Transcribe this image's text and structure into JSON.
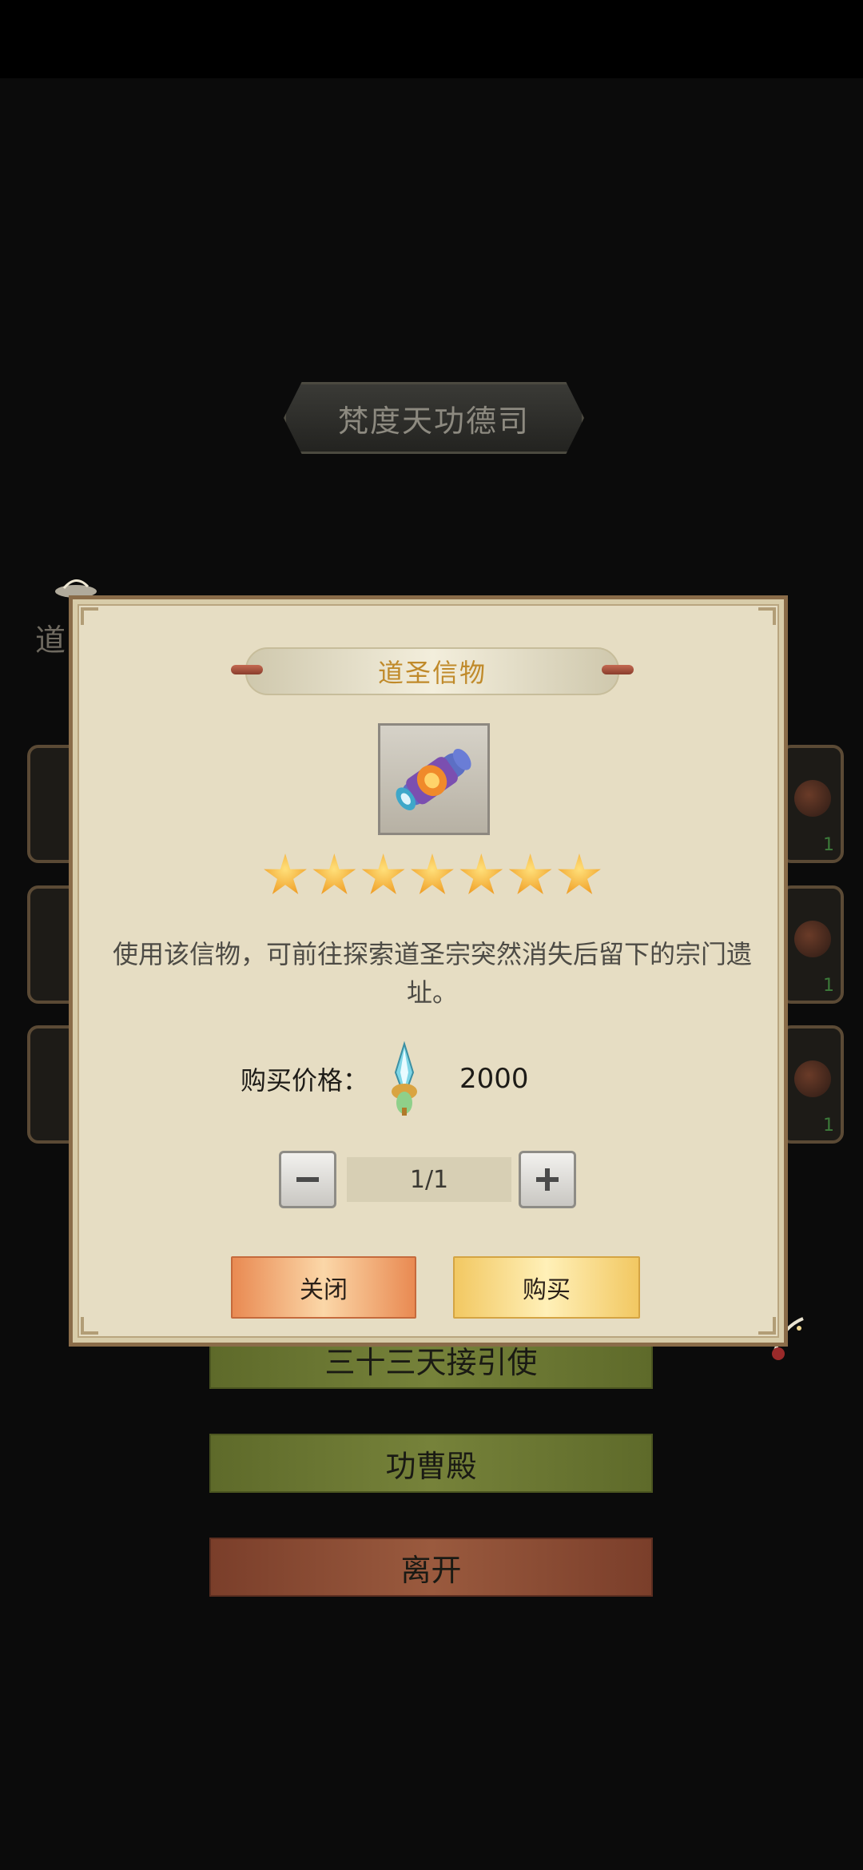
{
  "background": {
    "location_title": "梵度天功德司",
    "left_label_partial": "道",
    "menu": {
      "item1": "三十三天接引使",
      "item2": "功曹殿",
      "item3": "离开"
    },
    "slot_quantities": [
      "1",
      "1",
      "1"
    ]
  },
  "dialog": {
    "item_name": "道圣信物",
    "star_count": 7,
    "description": "使用该信物，可前往探索道圣宗突然消失后留下的宗门遗址。",
    "price_label": "购买价格：",
    "price_value": "2000",
    "quantity": "1/1",
    "close_label": "关闭",
    "buy_label": "购买"
  },
  "colors": {
    "dialog_bg": "#e6ddc3",
    "title_gold": "#c08a2a",
    "close_orange": "#e98a52",
    "buy_yellow": "#f2c862"
  },
  "icons": {
    "item": "scroll-icon",
    "currency": "jade-crystal-icon",
    "star": "star-icon"
  }
}
